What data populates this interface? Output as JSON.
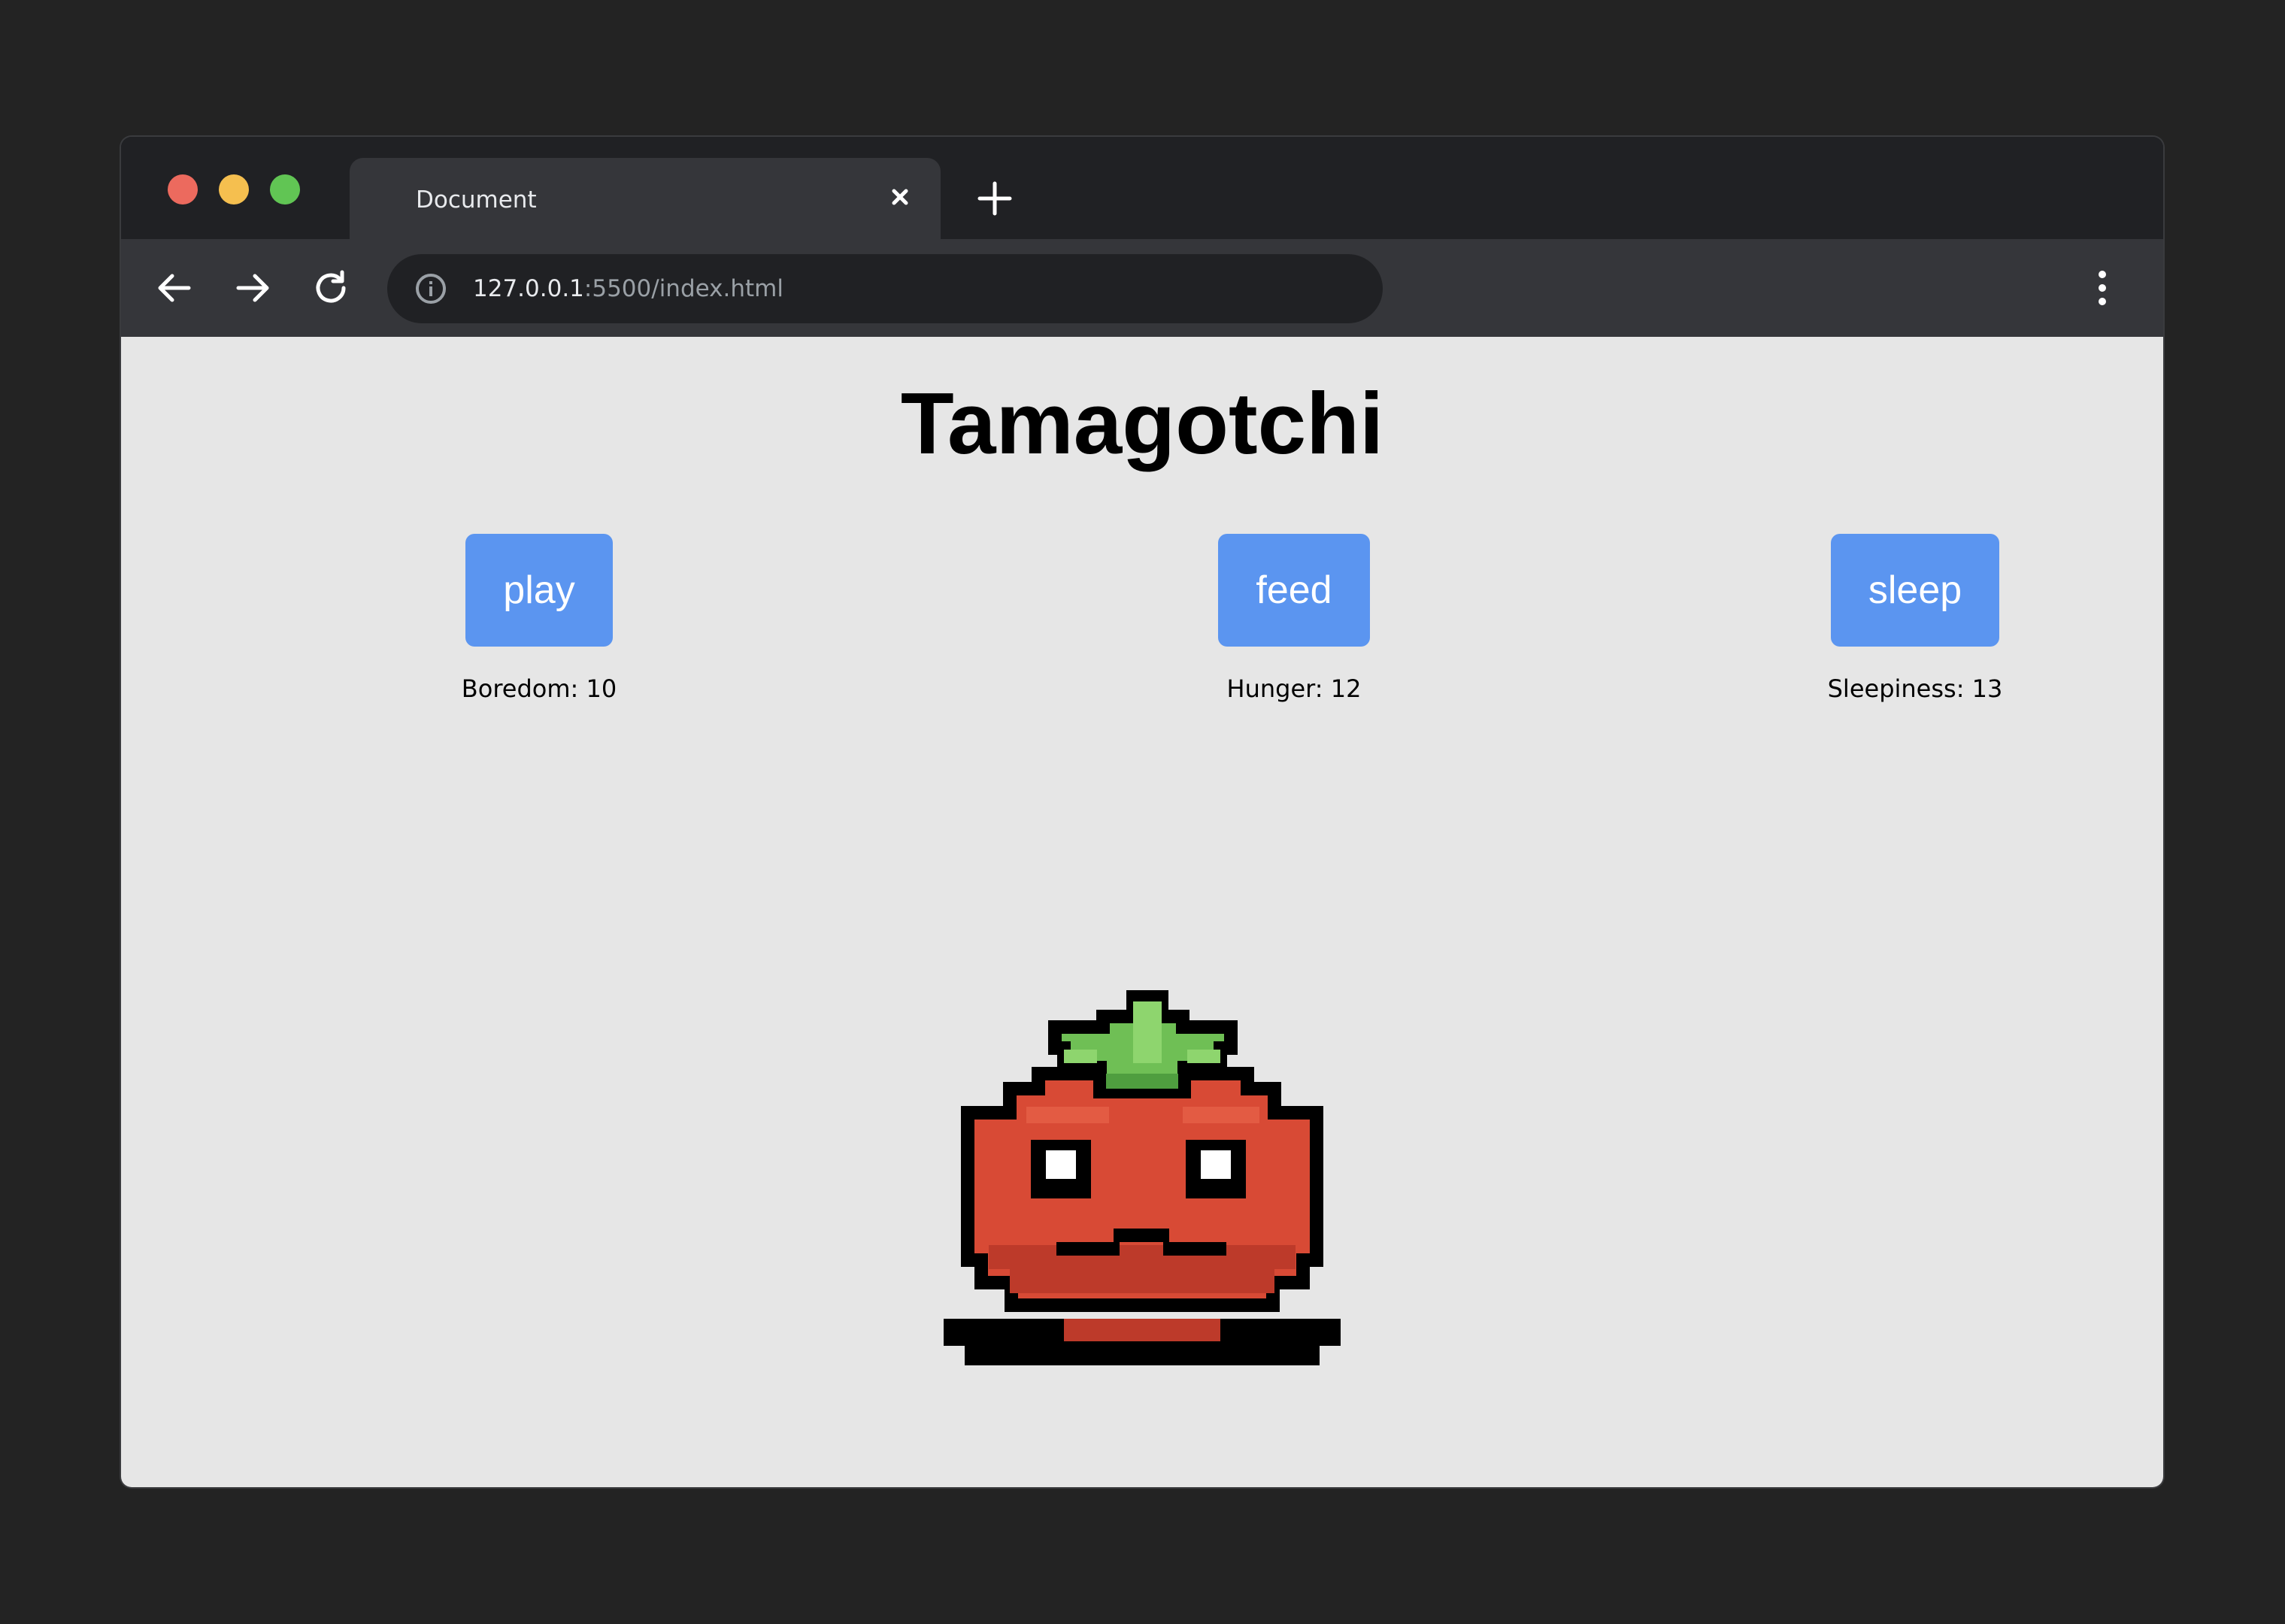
{
  "browser": {
    "tab_title": "Document",
    "url_host": "127.0.0.1",
    "url_path": ":5500/index.html"
  },
  "page": {
    "title": "Tamagotchi",
    "actions": [
      {
        "label": "play",
        "stat_label": "Boredom: 10"
      },
      {
        "label": "feed",
        "stat_label": "Hunger: 12"
      },
      {
        "label": "sleep",
        "stat_label": "Sleepiness: 13"
      }
    ]
  },
  "colors": {
    "button_bg": "#5b95f0",
    "page_bg": "#e6e6e6",
    "tomato": "#d84a35",
    "leaf": "#6fbf55"
  },
  "icons": {
    "close": "close-icon",
    "new_tab": "plus-icon",
    "back": "back-arrow-icon",
    "forward": "forward-arrow-icon",
    "reload": "reload-icon",
    "info": "info-icon",
    "menu": "more-vertical-icon",
    "pet": "tomato-pet-icon"
  }
}
